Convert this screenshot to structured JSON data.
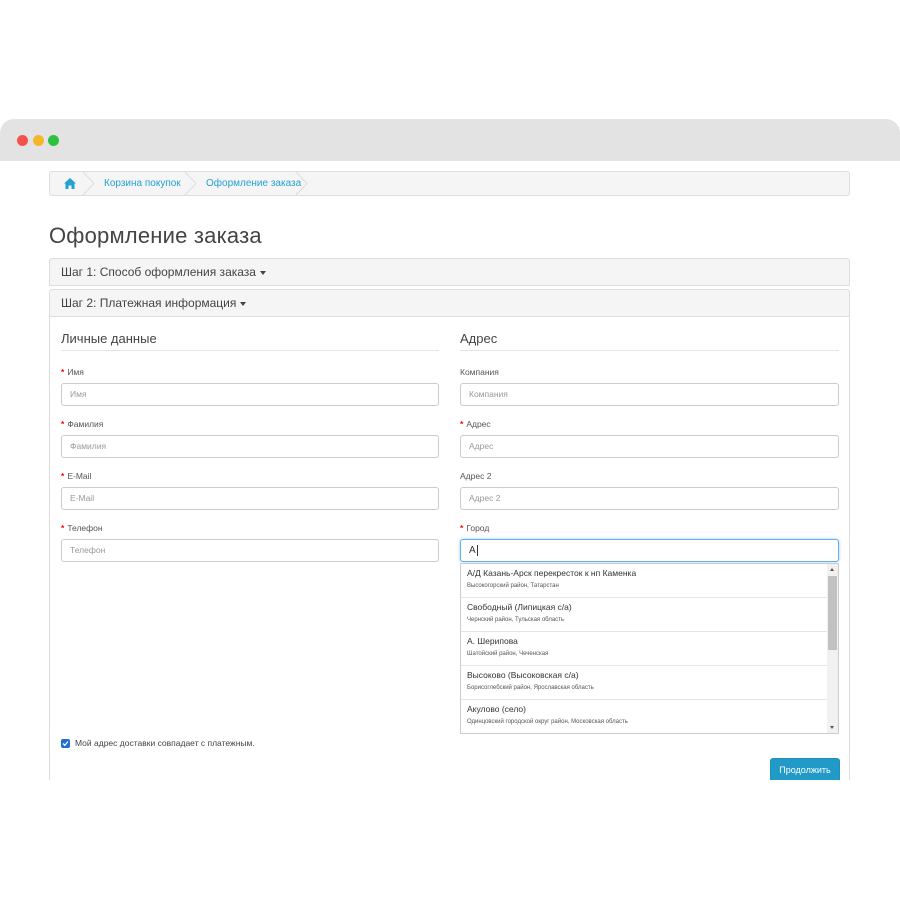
{
  "breadcrumb": {
    "items": [
      {
        "label": "Корзина покупок"
      },
      {
        "label": "Оформление заказа"
      }
    ]
  },
  "page": {
    "title": "Оформление заказа"
  },
  "steps": [
    {
      "label": "Шаг 1: Способ оформления заказа"
    },
    {
      "label": "Шаг 2: Платежная информация"
    }
  ],
  "personal": {
    "title": "Личные данные",
    "fields": [
      {
        "label": "Имя",
        "placeholder": "Имя",
        "required": true
      },
      {
        "label": "Фамилия",
        "placeholder": "Фамилия",
        "required": true
      },
      {
        "label": "E-Mail",
        "placeholder": "E-Mail",
        "required": true
      },
      {
        "label": "Телефон",
        "placeholder": "Телефон",
        "required": true
      }
    ]
  },
  "address": {
    "title": "Адрес",
    "fields": [
      {
        "label": "Компания",
        "placeholder": "Компания",
        "required": false
      },
      {
        "label": "Адрес",
        "placeholder": "Адрес",
        "required": true
      },
      {
        "label": "Адрес 2",
        "placeholder": "Адрес 2",
        "required": false
      },
      {
        "label": "Город",
        "value": "А",
        "required": true
      }
    ]
  },
  "suggestions": [
    {
      "name": "А/Д Казань-Арск перекресток к нп Каменка",
      "sub": "Высокогорский район, Татарстан"
    },
    {
      "name": "Свободный (Липицкая с/а)",
      "sub": "Чернский район, Тульская область"
    },
    {
      "name": "А. Шерипова",
      "sub": "Шатойский район, Чеченская"
    },
    {
      "name": "Высоково (Высоковская с/а)",
      "sub": "Борисоглебский район, Ярославская область"
    },
    {
      "name": "Акулово (село)",
      "sub": "Одинцовский городской округ район, Московская область"
    }
  ],
  "same_address": {
    "label": "Мой адрес доставки совпадает с платежным.",
    "checked": true
  },
  "continue_button": {
    "label": "Продолжить"
  },
  "colors": {
    "accent": "#229ac8",
    "link": "#23a1d1",
    "required": "#ff0000"
  }
}
